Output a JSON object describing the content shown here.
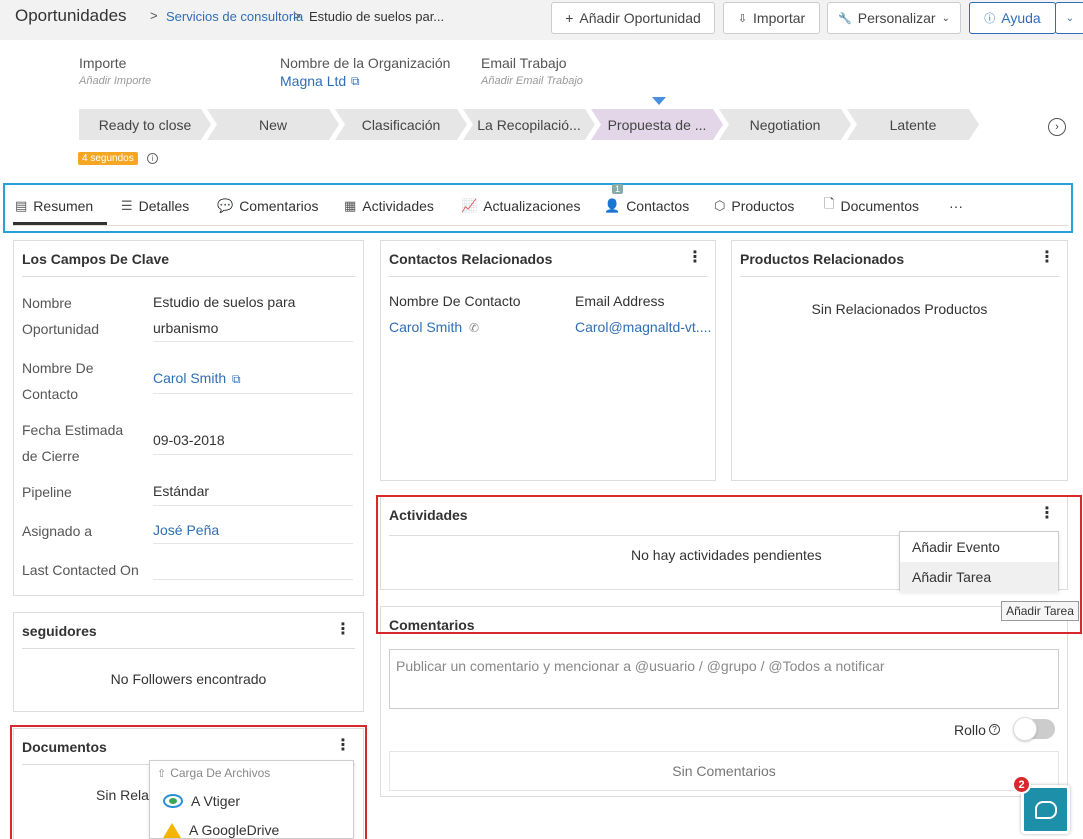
{
  "header": {
    "module": "Oportunidades",
    "separator": ">",
    "breadcrumb_link": "Servicios de consultoria",
    "breadcrumb_current": "Estudio de suelos par...",
    "add_label": "Añadir Oportunidad",
    "import_label": "Importar",
    "customize_label": "Personalizar",
    "help_label": "Ayuda"
  },
  "summary_fields": {
    "importe_label": "Importe",
    "importe_hint": "Añadir Importe",
    "org_label": "Nombre de la Organización",
    "org_value": "Magna Ltd",
    "email_label": "Email Trabajo",
    "email_hint": "Añadir Email Trabajo"
  },
  "stages": [
    "Ready to close",
    "New",
    "Clasificación",
    "La Recopilació...",
    "Propuesta de ...",
    "Negotiation",
    "Latente"
  ],
  "active_stage_index": 4,
  "timer": "4 segundos",
  "tabs": [
    "Resumen",
    "Detalles",
    "Comentarios",
    "Actividades",
    "Actualizaciones",
    "Contactos",
    "Productos",
    "Documentos",
    "···"
  ],
  "contacts_badge": "1",
  "key_fields": {
    "title": "Los Campos De Clave",
    "rows": [
      {
        "label": "Nombre Oportunidad",
        "value": "Estudio de suelos para urbanismo"
      },
      {
        "label": "Nombre De Contacto",
        "value": "Carol Smith"
      },
      {
        "label": "Fecha Estimada de Cierre",
        "value": "09-03-2018"
      },
      {
        "label": "Pipeline",
        "value": "Estándar"
      },
      {
        "label": "Asignado a",
        "value": "José Peña"
      },
      {
        "label": "Last Contacted On",
        "value": ""
      }
    ]
  },
  "followers": {
    "title": "seguidores",
    "empty": "No Followers encontrado"
  },
  "documents": {
    "title": "Documentos",
    "empty": "Sin Relac",
    "menu": {
      "header": "Carga De Archivos",
      "items": [
        "A Vtiger",
        "A GoogleDrive"
      ]
    }
  },
  "contacts": {
    "title": "Contactos Relacionados",
    "col_name": "Nombre De Contacto",
    "col_email": "Email Address",
    "name": "Carol Smith",
    "email": "Carol@magnaltd-vt...."
  },
  "products": {
    "title": "Productos Relacionados",
    "empty": "Sin Relacionados Productos"
  },
  "activities": {
    "title": "Actividades",
    "empty": "No hay actividades pendientes",
    "menu": [
      "Añadir Evento",
      "Añadir Tarea"
    ],
    "tooltip": "Añadir Tarea"
  },
  "comments": {
    "title": "Comentarios",
    "placeholder": "Publicar un comentario y mencionar a @usuario / @grupo / @Todos a notificar",
    "rollup_label": "Rollo",
    "empty": "Sin Comentarios"
  },
  "chat": {
    "badge": "2"
  },
  "colors": {
    "accent": "#2f6eb5",
    "tabs_border": "#27a0d9",
    "highlight": "#d9272e",
    "timer": "#f5a623"
  }
}
